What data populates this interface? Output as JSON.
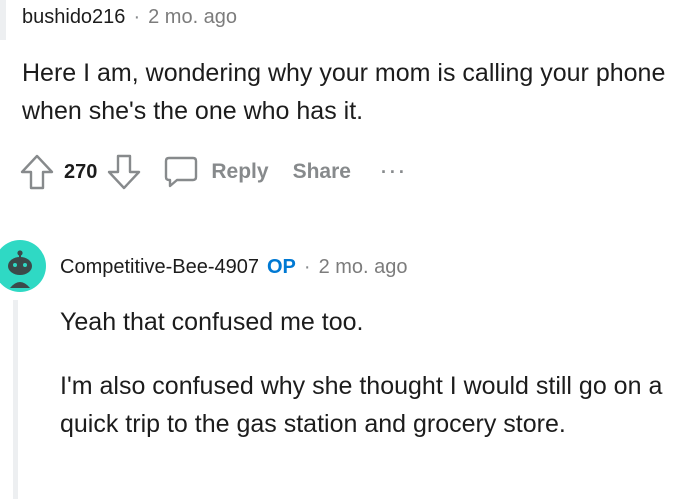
{
  "comment1": {
    "username": "bushido216",
    "separator": "·",
    "time": "2 mo. ago",
    "body": "Here I am, wondering why your mom is calling your phone when she's the one who has it.",
    "votes": "270",
    "reply_label": "Reply",
    "share_label": "Share",
    "more_label": "···"
  },
  "comment2": {
    "username": "Competitive-Bee-4907",
    "badge": "OP",
    "separator": "·",
    "time": "2 mo. ago",
    "paragraphs": [
      "Yeah that confused me too.",
      "I'm also confused why she thought I would still go on a quick trip to the gas station and grocery store."
    ],
    "avatar_color": "#2fd9c4"
  },
  "colors": {
    "meta_gray": "#7c7c7c",
    "action_gray": "#878a8c",
    "op_blue": "#0079d3",
    "text": "#1c1c1c"
  }
}
